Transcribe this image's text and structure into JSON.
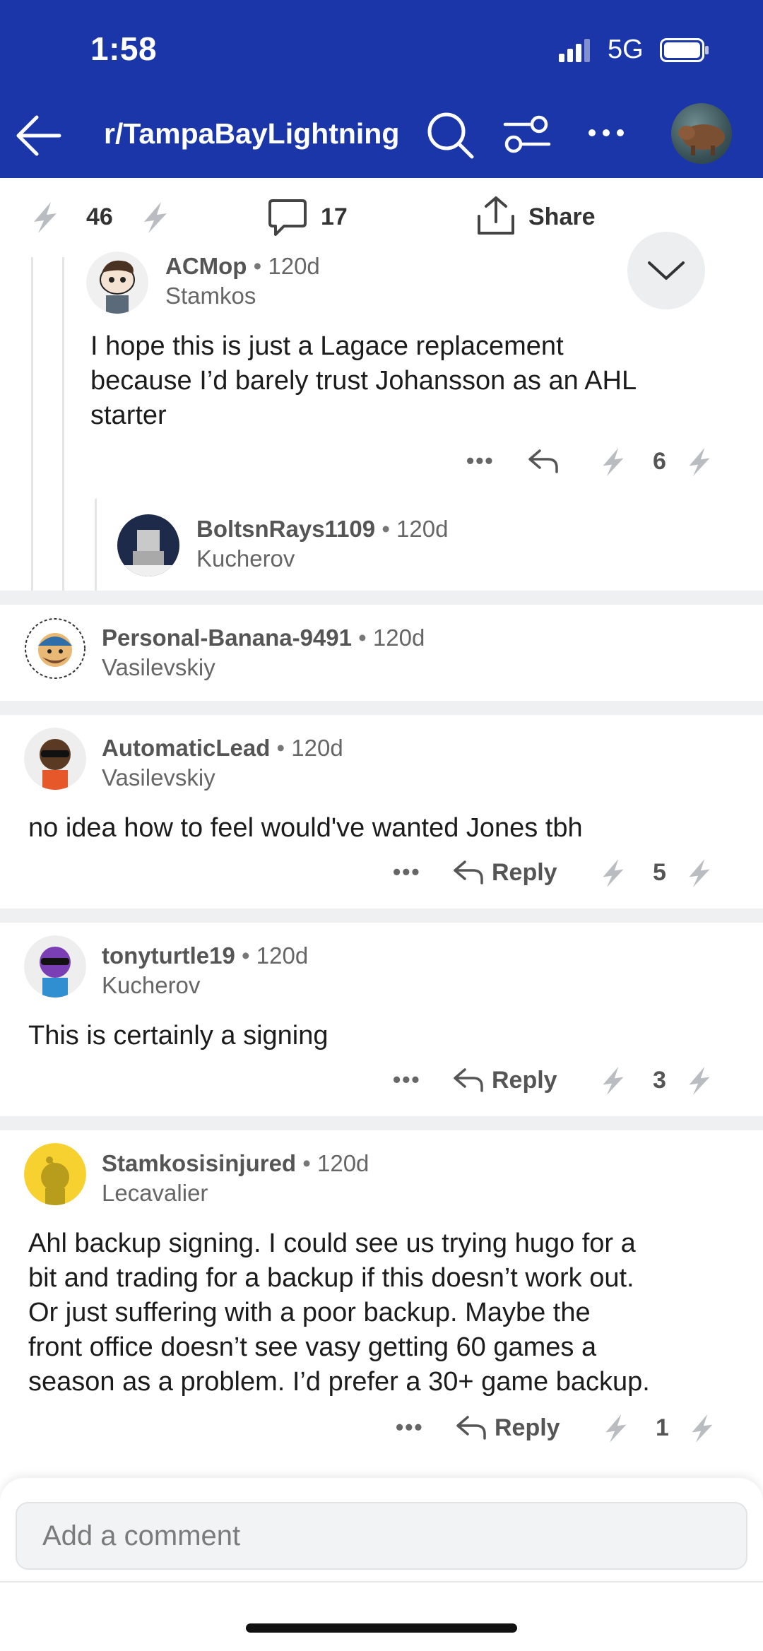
{
  "status": {
    "time": "1:58",
    "network": "5G"
  },
  "header": {
    "subreddit": "r/TampaBayLightning"
  },
  "action_bar": {
    "votes": "46",
    "comments": "17",
    "share_label": "Share"
  },
  "comments": [
    {
      "user": "ACMop",
      "age": "120d",
      "flair": "Stamkos",
      "text_lines": [
        "I hope this is just a Lagace replacement",
        "because I’d barely trust Johansson as an AHL",
        "starter"
      ],
      "votes": "6"
    },
    {
      "user": "BoltsnRays1109",
      "age": "120d",
      "flair": "Kucherov"
    },
    {
      "user": "Personal-Banana-9491",
      "age": "120d",
      "flair": "Vasilevskiy"
    },
    {
      "user": "AutomaticLead",
      "age": "120d",
      "flair": "Vasilevskiy",
      "text_lines": [
        "no idea how to feel would've wanted Jones tbh"
      ],
      "reply_label": "Reply",
      "votes": "5"
    },
    {
      "user": "tonyturtle19",
      "age": "120d",
      "flair": "Kucherov",
      "text_lines": [
        "This is certainly a signing"
      ],
      "reply_label": "Reply",
      "votes": "3"
    },
    {
      "user": "Stamkosisinjured",
      "age": "120d",
      "flair": "Lecavalier",
      "text_lines": [
        "Ahl backup signing. I could see us trying hugo for a",
        "bit and trading for a backup if this doesn’t work out.",
        "Or just suffering with a poor backup. Maybe the",
        "front office doesn’t see vasy getting 60 games a",
        "season as a problem. I’d prefer a 30+ game backup."
      ],
      "reply_label": "Reply",
      "votes": "1"
    }
  ],
  "composer": {
    "placeholder": "Add a comment"
  },
  "misc": {
    "more": "•••",
    "dot": "•"
  },
  "colors": {
    "header_bg": "#1a36a8",
    "separator": "#eef0f1"
  }
}
